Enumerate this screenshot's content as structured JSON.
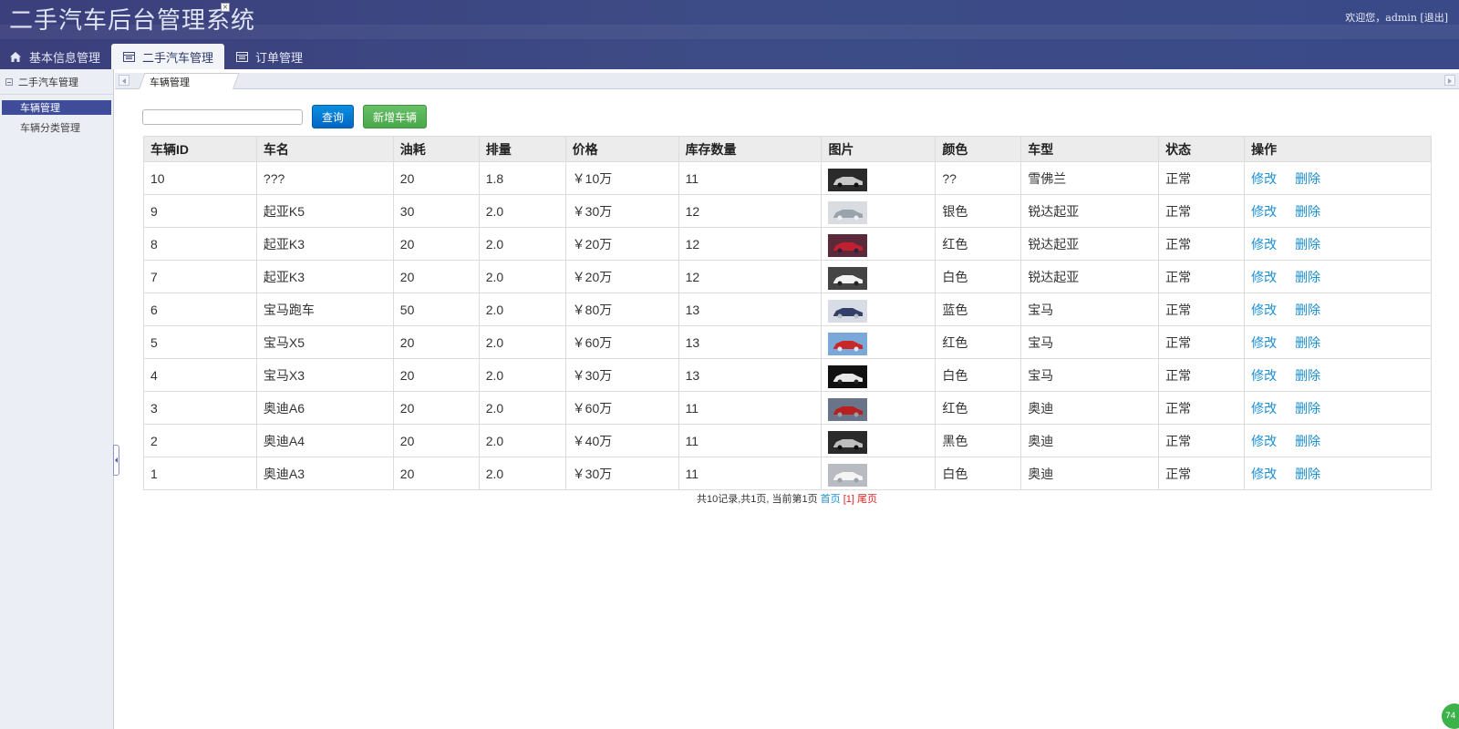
{
  "header": {
    "title": "二手汽车后台管理系统",
    "welcome": "欢迎您，admin",
    "logout": "[退出]"
  },
  "nav": {
    "tabs": [
      {
        "label": "基本信息管理",
        "icon": "home-icon"
      },
      {
        "label": "二手汽车管理",
        "icon": "table-icon"
      },
      {
        "label": "订单管理",
        "icon": "table-icon"
      }
    ],
    "active_index": 1
  },
  "sidebar": {
    "section_title": "二手汽车管理",
    "items": [
      {
        "label": "车辆管理",
        "active": true
      },
      {
        "label": "车辆分类管理",
        "active": false
      }
    ]
  },
  "content_tab": {
    "label": "车辆管理",
    "close": "×"
  },
  "toolbar": {
    "search_value": "",
    "search_placeholder": "",
    "query_label": "查询",
    "add_label": "新增车辆"
  },
  "table": {
    "columns": [
      "车辆ID",
      "车名",
      "油耗",
      "排量",
      "价格",
      "库存数量",
      "图片",
      "颜色",
      "车型",
      "状态",
      "操作"
    ],
    "edit_label": "修改",
    "delete_label": "删除",
    "rows": [
      {
        "id": "10",
        "name": "???",
        "fuel": "20",
        "displacement": "1.8",
        "price": "￥10万",
        "stock": "11",
        "color": "??",
        "model": "雪佛兰",
        "status": "正常",
        "thumb_colors": [
          "#2a2a2a",
          "#c8c8c8",
          "#101010"
        ]
      },
      {
        "id": "9",
        "name": "起亚K5",
        "fuel": "30",
        "displacement": "2.0",
        "price": "￥30万",
        "stock": "12",
        "color": "银色",
        "model": "锐达起亚",
        "status": "正常",
        "thumb_colors": [
          "#d9dde2",
          "#9aa3ab",
          "#eef0f2"
        ]
      },
      {
        "id": "8",
        "name": "起亚K3",
        "fuel": "20",
        "displacement": "2.0",
        "price": "￥20万",
        "stock": "12",
        "color": "红色",
        "model": "锐达起亚",
        "status": "正常",
        "thumb_colors": [
          "#5a2a3a",
          "#c02030",
          "#2a2040"
        ]
      },
      {
        "id": "7",
        "name": "起亚K3",
        "fuel": "20",
        "displacement": "2.0",
        "price": "￥20万",
        "stock": "12",
        "color": "白色",
        "model": "锐达起亚",
        "status": "正常",
        "thumb_colors": [
          "#444444",
          "#f2f2f2",
          "#222222"
        ]
      },
      {
        "id": "6",
        "name": "宝马跑车",
        "fuel": "50",
        "displacement": "2.0",
        "price": "￥80万",
        "stock": "13",
        "color": "蓝色",
        "model": "宝马",
        "status": "正常",
        "thumb_colors": [
          "#d8dce4",
          "#34406a",
          "#b8bec8"
        ]
      },
      {
        "id": "5",
        "name": "宝马X5",
        "fuel": "20",
        "displacement": "2.0",
        "price": "￥60万",
        "stock": "13",
        "color": "红色",
        "model": "宝马",
        "status": "正常",
        "thumb_colors": [
          "#7aa8d8",
          "#c82828",
          "#dfe8f2"
        ]
      },
      {
        "id": "4",
        "name": "宝马X3",
        "fuel": "20",
        "displacement": "2.0",
        "price": "￥30万",
        "stock": "13",
        "color": "白色",
        "model": "宝马",
        "status": "正常",
        "thumb_colors": [
          "#111111",
          "#e8e8e8",
          "#222222"
        ]
      },
      {
        "id": "3",
        "name": "奥迪A6",
        "fuel": "20",
        "displacement": "2.0",
        "price": "￥60万",
        "stock": "11",
        "color": "红色",
        "model": "奥迪",
        "status": "正常",
        "thumb_colors": [
          "#6a7488",
          "#b82020",
          "#9aa0aa"
        ]
      },
      {
        "id": "2",
        "name": "奥迪A4",
        "fuel": "20",
        "displacement": "2.0",
        "price": "￥40万",
        "stock": "11",
        "color": "黑色",
        "model": "奥迪",
        "status": "正常",
        "thumb_colors": [
          "#2a2a2a",
          "#bdbdbd",
          "#0e0e0e"
        ]
      },
      {
        "id": "1",
        "name": "奥迪A3",
        "fuel": "20",
        "displacement": "2.0",
        "price": "￥30万",
        "stock": "11",
        "color": "白色",
        "model": "奥迪",
        "status": "正常",
        "thumb_colors": [
          "#b8bcc2",
          "#f4f4f4",
          "#9aa0a8"
        ]
      }
    ]
  },
  "pager": {
    "summary": "共10记录,共1页, 当前第1页",
    "first": "首页",
    "current": "[1]",
    "last": "尾页"
  },
  "corner_badge": "74",
  "colors": {
    "header_bg": "#3b3f7c",
    "link": "#1b8ed1",
    "query_button": "#0366c3",
    "add_button": "#4aa84a",
    "sidebar_active": "#3f4c9a"
  }
}
